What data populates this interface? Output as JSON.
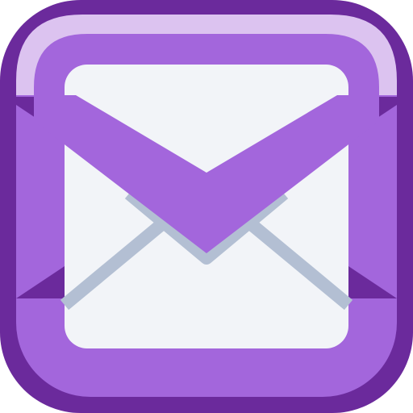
{
  "icon": {
    "name": "mail-envelope-icon",
    "colors": {
      "outer_frame": "#6b2a9c",
      "frame_body": "#a366dc",
      "highlight": "#dcc3f0",
      "side_panel": "#6b2a9c",
      "paper": "#f2f4f8",
      "fold_lines": "#b3bfd3"
    }
  }
}
